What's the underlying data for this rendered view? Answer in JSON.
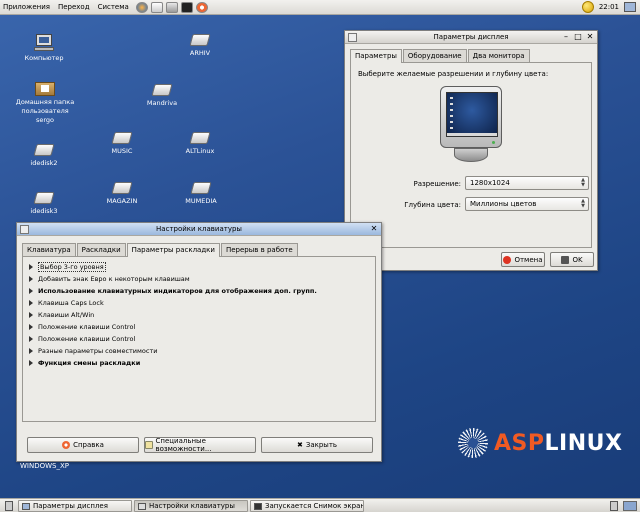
{
  "top_panel": {
    "menus": [
      "Приложения",
      "Переход",
      "Система"
    ],
    "launchers": [
      "browser-icon",
      "mail-icon",
      "office-icon",
      "terminal-icon",
      "help-icon"
    ],
    "clock": "22:01"
  },
  "desktop": {
    "icons": [
      {
        "label": "Компьютер",
        "type": "computer-icon"
      },
      {
        "label": "ARHIV",
        "type": "drive-icon"
      },
      {
        "label": "Домашняя папка пользователя sergo",
        "type": "home-folder-icon"
      },
      {
        "label": "Mandriva",
        "type": "drive-icon"
      },
      {
        "label": "idedisk2",
        "type": "drive-icon"
      },
      {
        "label": "MUSIC",
        "type": "drive-icon"
      },
      {
        "label": "ALTLinux",
        "type": "drive-icon"
      },
      {
        "label": "idedisk3",
        "type": "drive-icon"
      },
      {
        "label": "MAGAZIN",
        "type": "drive-icon"
      },
      {
        "label": "MUMEDIA",
        "type": "drive-icon"
      }
    ],
    "home_label_line1": "Домашняя папка",
    "home_label_line2": "пользователя sergo",
    "windows_xp": "WINDOWS_XP"
  },
  "display_window": {
    "title": "Параметры дисплея",
    "tabs": [
      "Параметры",
      "Оборудование",
      "Два монитора"
    ],
    "active_tab": "Параметры",
    "prompt": "Выберите желаемые разрешении и глубину цвета:",
    "resolution_label": "Разрешение:",
    "resolution_value": "1280x1024",
    "depth_label": "Глубина цвета:",
    "depth_value": "Миллионы цветов",
    "cancel": "Отмена",
    "ok": "OK"
  },
  "keyboard_window": {
    "title": "Настройки клавиатуры",
    "tabs": [
      "Клавиатура",
      "Раскладки",
      "Параметры раскладки",
      "Перерыв в работе"
    ],
    "active_tab": "Параметры раскладки",
    "options": [
      {
        "label": "Выбор 3-го уровня",
        "bold": false,
        "selected": true
      },
      {
        "label": "Добавить знак Евро к некоторым клавишам",
        "bold": false,
        "selected": false
      },
      {
        "label": "Использование клавиатурных индикаторов для отображения доп. групп.",
        "bold": true,
        "selected": false
      },
      {
        "label": "Клавиша Caps Lock",
        "bold": false,
        "selected": false
      },
      {
        "label": "Клавиши Alt/Win",
        "bold": false,
        "selected": false
      },
      {
        "label": "Положение клавиши Control",
        "bold": false,
        "selected": false
      },
      {
        "label": "Положение клавиши Control",
        "bold": false,
        "selected": false
      },
      {
        "label": "Разные параметры совместимости",
        "bold": false,
        "selected": false
      },
      {
        "label": "Функция смены раскладки",
        "bold": true,
        "selected": false
      }
    ],
    "help": "Справка",
    "accessibility": "Специальные возможности...",
    "close": "Закрыть"
  },
  "logo": {
    "asp": "ASP",
    "linux": "LINUX"
  },
  "taskbar": {
    "tasks": [
      {
        "label": "Параметры дисплея",
        "pressed": false
      },
      {
        "label": "Настройки клавиатуры",
        "pressed": true
      },
      {
        "label": "Запускается Снимок экрана",
        "pressed": false
      }
    ]
  },
  "colors": {
    "desktop": "#2b5296",
    "logo_accent": "#f05a23",
    "window_bg": "#ecebe7",
    "active_title": "#9bb8de"
  }
}
